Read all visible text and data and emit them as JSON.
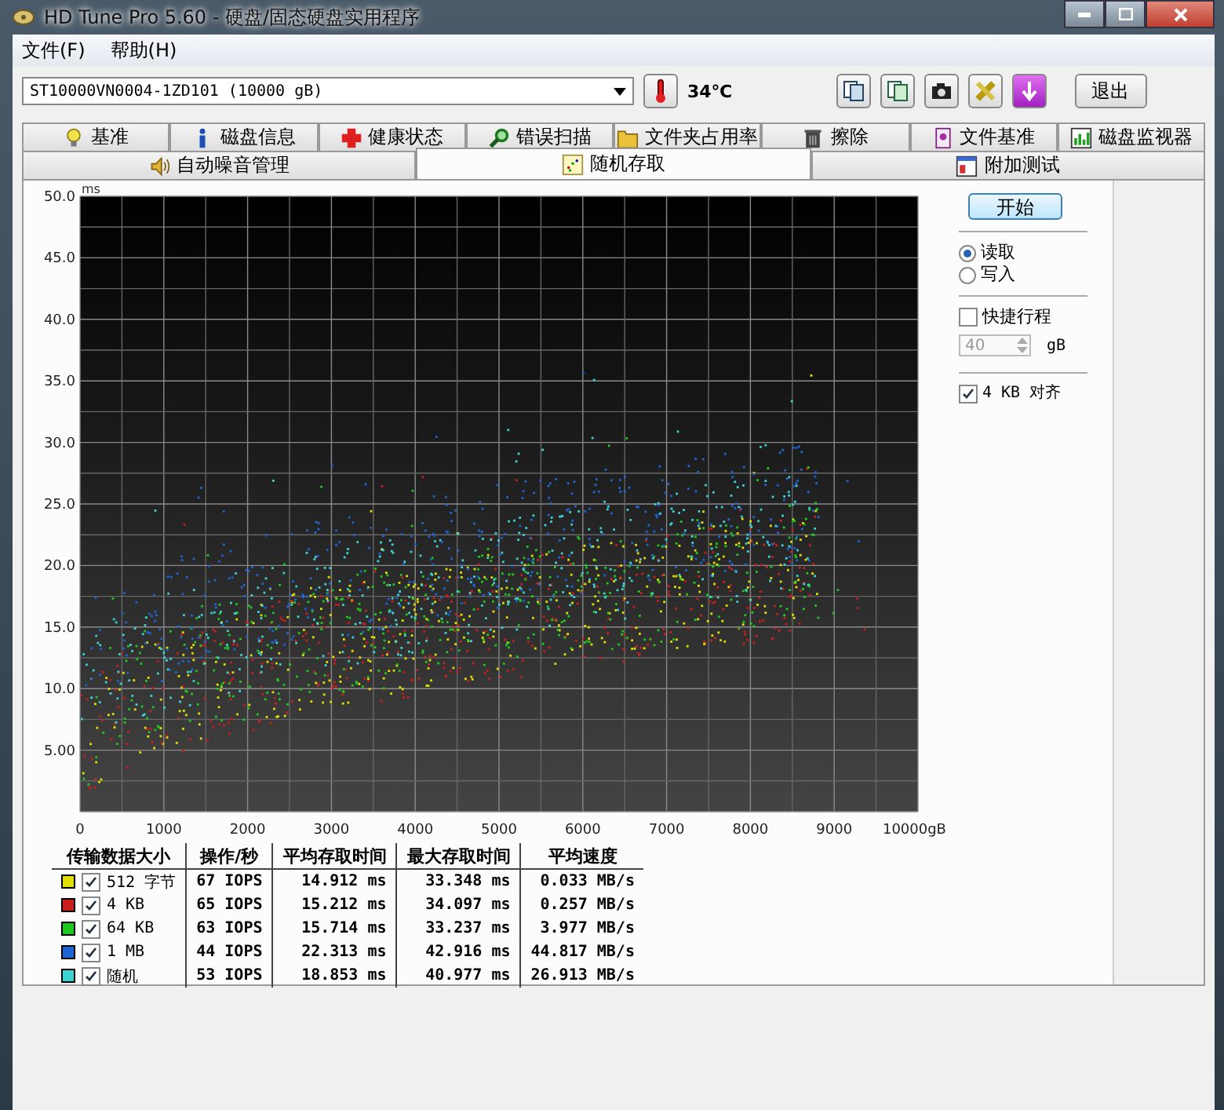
{
  "window": {
    "title": "HD Tune Pro 5.60 - 硬盘/固态硬盘实用程序"
  },
  "menu": [
    "文件(F)",
    "帮助(H)"
  ],
  "toolbar": {
    "drive": "ST10000VN0004-1ZD101 (10000 gB)",
    "temperature": "34℃",
    "exit": "退出"
  },
  "tabs_row1": [
    {
      "label": "基准",
      "selected": false
    },
    {
      "label": "磁盘信息",
      "selected": false
    },
    {
      "label": "健康状态",
      "selected": false
    },
    {
      "label": "错误扫描",
      "selected": false
    },
    {
      "label": "文件夹占用率",
      "selected": false
    },
    {
      "label": "擦除",
      "selected": false
    },
    {
      "label": "文件基准",
      "selected": false
    },
    {
      "label": "磁盘监视器",
      "selected": false
    }
  ],
  "tabs_row2": [
    {
      "label": "自动噪音管理",
      "selected": false
    },
    {
      "label": "随机存取",
      "selected": true
    },
    {
      "label": "附加测试",
      "selected": false
    }
  ],
  "plot": {
    "unit": "ms",
    "y_labels": [
      "50.0",
      "45.0",
      "40.0",
      "35.0",
      "30.0",
      "25.0",
      "20.0",
      "15.0",
      "10.0",
      "5.00"
    ],
    "x_labels": [
      "0",
      "1000",
      "2000",
      "3000",
      "4000",
      "5000",
      "6000",
      "7000",
      "8000",
      "9000",
      "10000gB"
    ]
  },
  "side": {
    "start": "开始",
    "modes": [
      {
        "label": "读取",
        "selected": true
      },
      {
        "label": "写入",
        "selected": false
      }
    ],
    "short_stroke": {
      "label": "快捷行程",
      "checked": false
    },
    "stroke_value": "40",
    "stroke_unit": "gB",
    "align": {
      "label": "4 KB 对齐",
      "checked": true
    }
  },
  "results": {
    "columns": [
      "传输数据大小",
      "操作/秒",
      "平均存取时间",
      "最大存取时间",
      "平均速度"
    ],
    "rows": [
      {
        "color": "#e0e000",
        "checked": true,
        "cells": [
          "512 字节",
          "67 IOPS",
          "14.912 ms",
          "33.348 ms",
          "0.033 MB/s"
        ]
      },
      {
        "color": "#c81e1e",
        "checked": true,
        "cells": [
          "4 KB",
          "65 IOPS",
          "15.212 ms",
          "34.097 ms",
          "0.257 MB/s"
        ]
      },
      {
        "color": "#1ec81e",
        "checked": true,
        "cells": [
          "64 KB",
          "63 IOPS",
          "15.714 ms",
          "33.237 ms",
          "3.977 MB/s"
        ]
      },
      {
        "color": "#1e64d2",
        "checked": true,
        "cells": [
          "1 MB",
          "44 IOPS",
          "22.313 ms",
          "42.916 ms",
          "44.817 MB/s"
        ]
      },
      {
        "color": "#3cd2d2",
        "checked": true,
        "cells": [
          "随机",
          "53 IOPS",
          "18.853 ms",
          "40.977 ms",
          "26.913 MB/s"
        ]
      }
    ]
  }
}
